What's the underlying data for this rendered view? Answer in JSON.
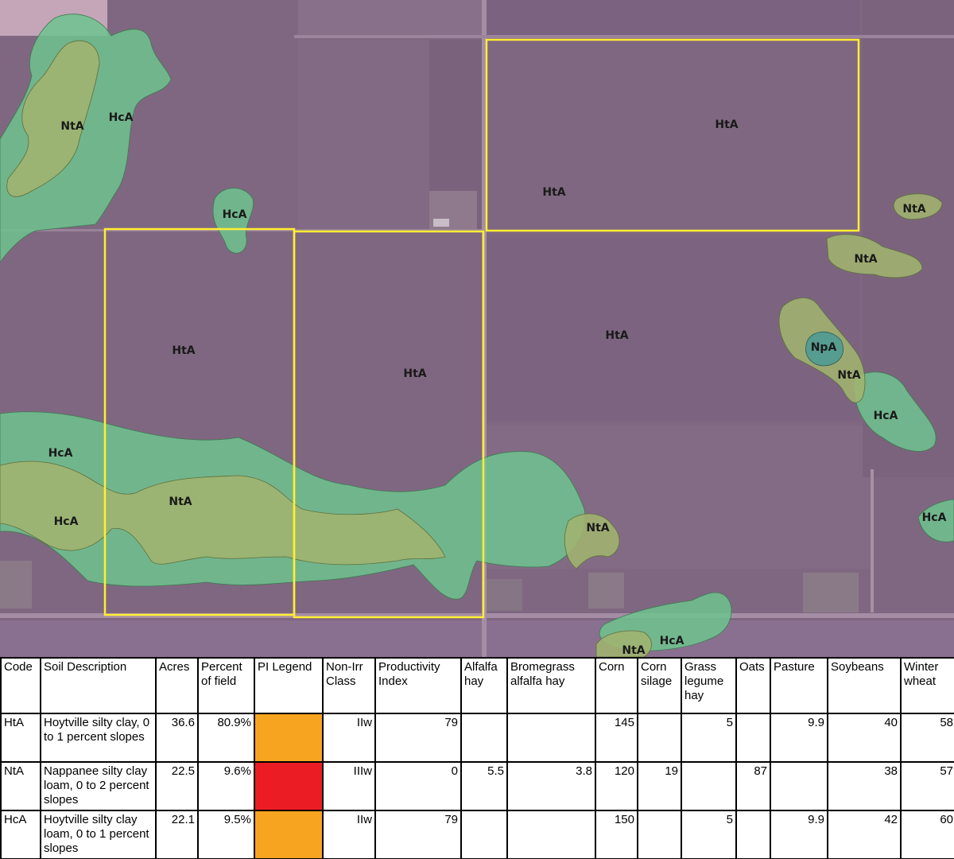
{
  "map": {
    "polygon_colors": {
      "field_boundary": "#ffee33",
      "HtA": "#7e6680",
      "NtA": "#a0b470",
      "HcA": "#6fc38f",
      "NpA": "#4f9a94"
    },
    "labels": [
      "NtA",
      "HcA",
      "HcA",
      "HtA",
      "HtA",
      "NtA",
      "NtA",
      "HtA",
      "HtA",
      "HtA",
      "NpA",
      "NtA",
      "HcA",
      "HcA",
      "NtA",
      "HcA",
      "NtA",
      "HcA",
      "NtA",
      "HcA"
    ]
  },
  "table": {
    "headers": [
      "Code",
      "Soil Description",
      "Acres",
      "Percent of field",
      "PI Legend",
      "Non-Irr Class",
      "Productivity Index",
      "Alfalfa hay",
      "Bromegrass alfalfa hay",
      "Corn",
      "Corn silage",
      "Grass legume hay",
      "Oats",
      "Pasture",
      "Soybeans",
      "Winter wheat"
    ],
    "rows": [
      {
        "code": "HtA",
        "description": "Hoytville silty clay, 0 to 1 percent slopes",
        "acres": "36.6",
        "percent": "80.9%",
        "pi_color": "#f7a420",
        "class": "IIw",
        "pi": "79",
        "alfalfa": "",
        "brome": "",
        "corn": "145",
        "silage": "",
        "grass": "5",
        "oats": "",
        "pasture": "9.9",
        "soy": "40",
        "wheat": "58"
      },
      {
        "code": "NtA",
        "description": "Nappanee silty clay loam, 0 to 2 percent slopes",
        "acres": "22.5",
        "percent": "9.6%",
        "pi_color": "#ec1c24",
        "class": "IIIw",
        "pi": "0",
        "alfalfa": "5.5",
        "brome": "3.8",
        "corn": "120",
        "silage": "19",
        "grass": "",
        "oats": "87",
        "pasture": "",
        "soy": "38",
        "wheat": "57"
      },
      {
        "code": "HcA",
        "description": "Hoytville silty clay loam, 0 to 1 percent slopes",
        "acres": "22.1",
        "percent": "9.5%",
        "pi_color": "#f7a420",
        "class": "IIw",
        "pi": "79",
        "alfalfa": "",
        "brome": "",
        "corn": "150",
        "silage": "",
        "grass": "5",
        "oats": "",
        "pasture": "9.9",
        "soy": "42",
        "wheat": "60"
      }
    ]
  }
}
